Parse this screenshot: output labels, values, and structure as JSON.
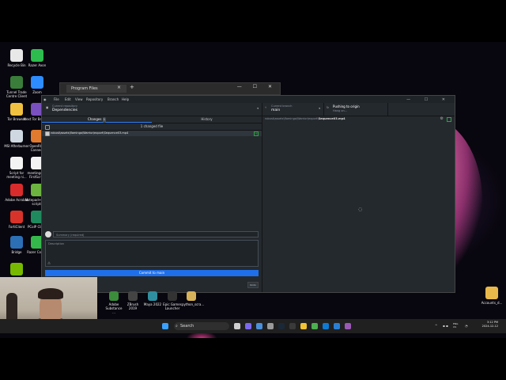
{
  "desktop": {
    "icons": [
      {
        "label": "Recycle Bin",
        "color": "#e8e8e8"
      },
      {
        "label": "Razer Axon",
        "color": "#2dbd4e"
      },
      {
        "label": "Tunnel Trade Centre Client",
        "color": "#3a7d3a"
      },
      {
        "label": "Zoom",
        "color": "#2d8cff"
      },
      {
        "label": "Tor Browser",
        "color": "#f0c040"
      },
      {
        "label": "Next Tor Browser",
        "color": "#7a4fbf"
      },
      {
        "label": "MSI Afterburner",
        "color": "#cfd8e0"
      },
      {
        "label": "OpenRGB Connect",
        "color": "#e07a2e"
      },
      {
        "label": "Script for meeting ni...",
        "color": "#f3f3f3"
      },
      {
        "label": "meetingsE... FirstScript",
        "color": "#f3f3f3"
      },
      {
        "label": "Adobe Acrobat",
        "color": "#d92b2b"
      },
      {
        "label": "Notepad++ for scripts",
        "color": "#6cb33f"
      },
      {
        "label": "FortiClient",
        "color": "#d8332b"
      },
      {
        "label": "PCoIP Client",
        "color": "#1f8a5e"
      },
      {
        "label": "Bridge",
        "color": "#2c6fb5"
      },
      {
        "label": "Razer Cortex",
        "color": "#35b84b"
      },
      {
        "label": "GeForce",
        "color": "#76b900"
      }
    ],
    "right_icon": {
      "label": "Accounts_d...",
      "color": "#e8b84a"
    },
    "taskbar_apps": [
      {
        "label": "Adobe Substance ...",
        "color": "#3b8c3b"
      },
      {
        "label": "ZBrush 2019",
        "color": "#444444"
      },
      {
        "label": "Maya 2022",
        "color": "#2f8fa0"
      },
      {
        "label": "Epic Games Launcher",
        "color": "#333333"
      },
      {
        "label": "python_scra...",
        "color": "#d6b35a"
      }
    ]
  },
  "explorer_window": {
    "tab_title": "Program Files",
    "close_glyph": "×",
    "new_tab_glyph": "+",
    "window_controls": "— ☐ ✕"
  },
  "github": {
    "menu": [
      "File",
      "Edit",
      "View",
      "Repository",
      "Branch",
      "Help"
    ],
    "window_controls": "— ☐ ✕",
    "current_repository": {
      "label": "Current repository",
      "value": "Dependencies"
    },
    "current_branch": {
      "label": "Current branch",
      "value": "main"
    },
    "push": {
      "label": "Pushing to origin",
      "sub": "Hang on..."
    },
    "tabs": {
      "changes": "Changes",
      "changes_count": "1",
      "history": "History"
    },
    "changed_files_header": "1 changed file",
    "file_path": "robust\\assets\\flamingo\\Warrior\\export\\Sequence03.mp4",
    "summary_placeholder": "Summary (required)",
    "description_placeholder": "Description",
    "commit_button": "Commit to main",
    "undo_label": "Undo",
    "diff_path_prefix": "robust\\assets\\flamingo\\Warrior\\export\\",
    "diff_path_file": "Sequence03.mp4",
    "spinner_glyph": "◌"
  },
  "taskbar": {
    "search_placeholder": "Search",
    "language": "ENG\nUS",
    "time": "3:12 PM",
    "date": "2024-12-12"
  }
}
